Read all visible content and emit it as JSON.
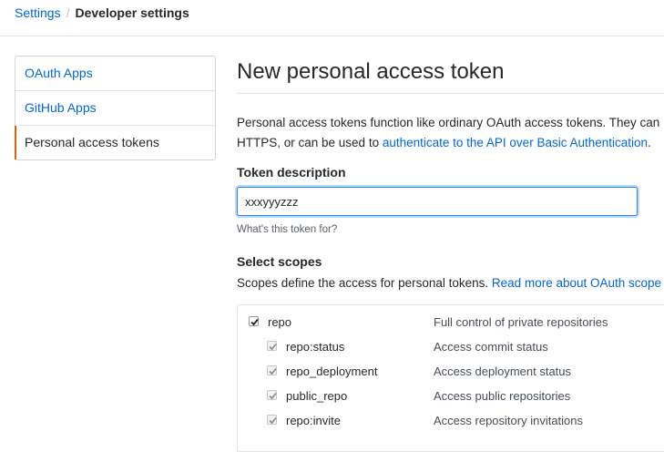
{
  "breadcrumb": {
    "root": "Settings",
    "separator": "/",
    "current": "Developer settings"
  },
  "sidebar": {
    "items": [
      {
        "label": "OAuth Apps",
        "selected": false
      },
      {
        "label": "GitHub Apps",
        "selected": false
      },
      {
        "label": "Personal access tokens",
        "selected": true
      }
    ]
  },
  "main": {
    "title": "New personal access token",
    "intro_line1": "Personal access tokens function like ordinary OAuth access tokens. They can",
    "intro_line2_prefix": "HTTPS, or can be used to ",
    "intro_link": "authenticate to the API over Basic Authentication",
    "intro_line2_suffix": ".",
    "token_label": "Token description",
    "token_value": "xxxyyyzzz",
    "token_hint": "What's this token for?",
    "scopes_label": "Select scopes",
    "scopes_desc_prefix": "Scopes define the access for personal tokens. ",
    "scopes_link": "Read more about OAuth scope"
  },
  "scopes": [
    {
      "name": "repo",
      "description": "Full control of private repositories",
      "checked": true,
      "child": false
    },
    {
      "name": "repo:status",
      "description": "Access commit status",
      "checked": true,
      "child": true
    },
    {
      "name": "repo_deployment",
      "description": "Access deployment status",
      "checked": true,
      "child": true
    },
    {
      "name": "public_repo",
      "description": "Access public repositories",
      "checked": true,
      "child": true
    },
    {
      "name": "repo:invite",
      "description": "Access repository invitations",
      "checked": true,
      "child": true
    }
  ],
  "colors": {
    "link": "#0366d6",
    "selected_accent": "#e36209",
    "focus_border": "#2188ff"
  }
}
